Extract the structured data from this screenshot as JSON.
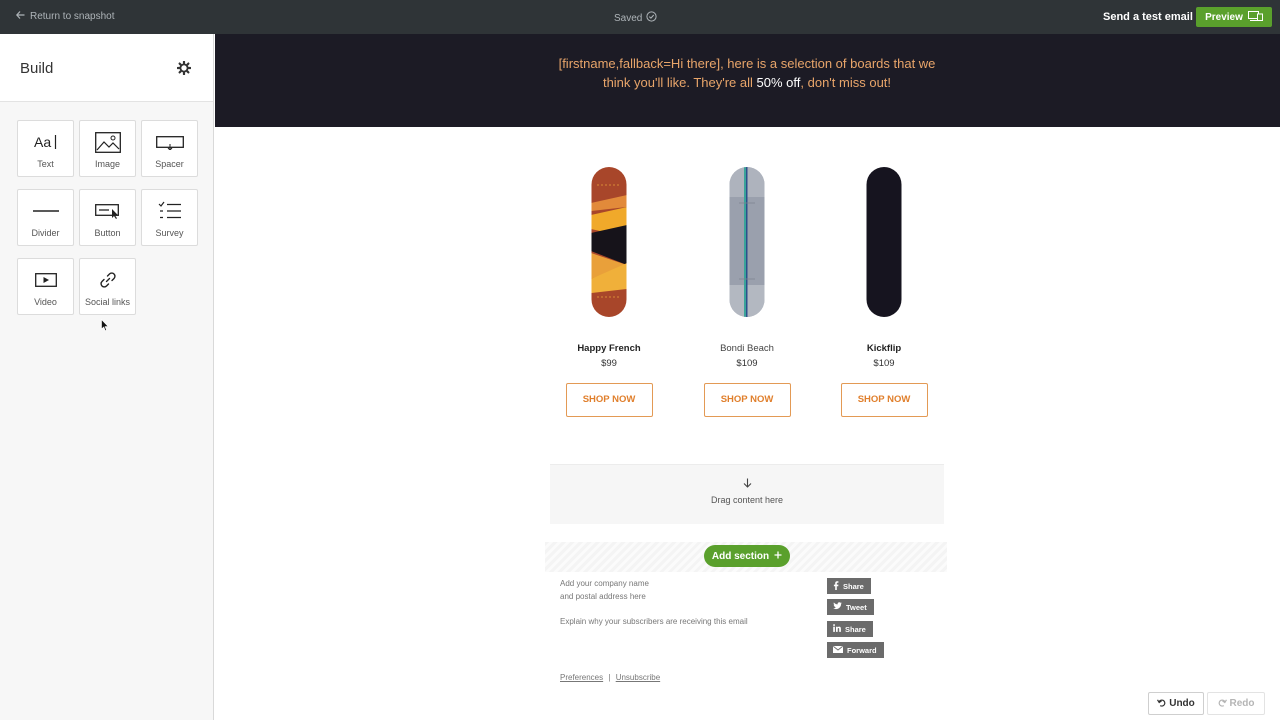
{
  "topbar": {
    "back_label": "Return to snapshot",
    "status": "Saved",
    "send_test_label": "Send a test email",
    "preview_label": "Preview"
  },
  "sidebar": {
    "title": "Build",
    "tiles": [
      {
        "label": "Text",
        "icon": "text-icon"
      },
      {
        "label": "Image",
        "icon": "image-icon"
      },
      {
        "label": "Spacer",
        "icon": "spacer-icon"
      },
      {
        "label": "Divider",
        "icon": "divider-icon"
      },
      {
        "label": "Button",
        "icon": "button-icon"
      },
      {
        "label": "Survey",
        "icon": "survey-icon"
      },
      {
        "label": "Video",
        "icon": "video-icon"
      },
      {
        "label": "Social links",
        "icon": "link-icon"
      }
    ]
  },
  "email": {
    "hero_part1": "[firstname,fallback=Hi there], here is a selection of boards that we think you'll like. They're all ",
    "hero_highlight": "50% off",
    "hero_part2": ", don't miss out!",
    "products": [
      {
        "name": "Happy French",
        "price": "$99",
        "cta": "SHOP NOW"
      },
      {
        "name": "Bondi Beach",
        "price": "$109",
        "cta": "SHOP NOW"
      },
      {
        "name": "Kickflip",
        "price": "$109",
        "cta": "SHOP NOW"
      }
    ],
    "dropzone_label": "Drag content here",
    "add_section_label": "Add section",
    "footer": {
      "address_line1": "Add your company name",
      "address_line2": "and postal address here",
      "reason": "Explain why your subscribers are receiving this email",
      "preferences": "Preferences",
      "separator": "|",
      "unsubscribe": "Unsubscribe"
    },
    "social": [
      {
        "label": "Share",
        "icon": "facebook-icon"
      },
      {
        "label": "Tweet",
        "icon": "twitter-icon"
      },
      {
        "label": "Share",
        "icon": "linkedin-icon"
      },
      {
        "label": "Forward",
        "icon": "mail-icon"
      }
    ]
  },
  "history": {
    "undo_label": "Undo",
    "redo_label": "Redo"
  },
  "colors": {
    "accent_green": "#5aa02c",
    "hero_bg": "#1c1b25",
    "hero_text": "#e8a56a",
    "cta_orange": "#e07f2c"
  }
}
